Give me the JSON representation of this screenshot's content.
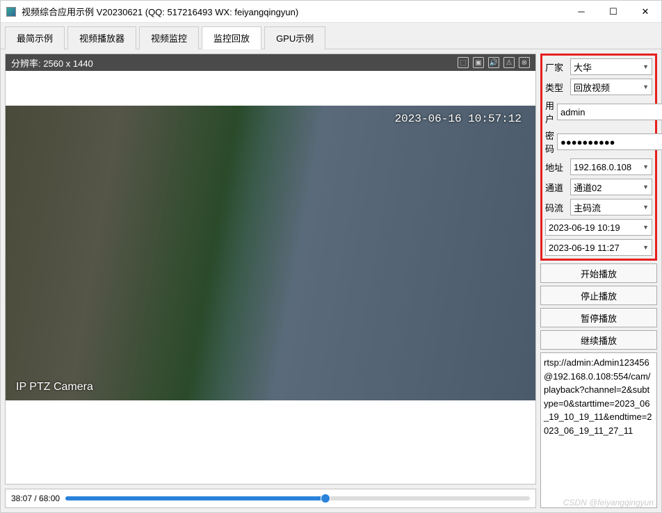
{
  "window": {
    "title": "视频综合应用示例 V20230621 (QQ: 517216493 WX: feiyangqingyun)"
  },
  "tabs": {
    "items": [
      {
        "label": "最简示例"
      },
      {
        "label": "视频播放器"
      },
      {
        "label": "视频监控"
      },
      {
        "label": "监控回放"
      },
      {
        "label": "GPU示例"
      }
    ],
    "active_index": 3
  },
  "video": {
    "resolution_label": "分辨率: 2560 x 1440",
    "osd_timestamp": "2023-06-16 10:57:12",
    "osd_camera": "IP PTZ Camera"
  },
  "progress": {
    "time_label": "38:07 / 68:00",
    "percent": 56
  },
  "form": {
    "vendor": {
      "label": "厂家",
      "value": "大华"
    },
    "type": {
      "label": "类型",
      "value": "回放视频"
    },
    "user": {
      "label": "用户",
      "value": "admin"
    },
    "password": {
      "label": "密码",
      "value": "●●●●●●●●●●"
    },
    "address": {
      "label": "地址",
      "value": "192.168.0.108"
    },
    "channel": {
      "label": "通道",
      "value": "通道02"
    },
    "stream": {
      "label": "码流",
      "value": "主码流"
    },
    "start_time": "2023-06-19 10:19",
    "end_time": "2023-06-19 11:27"
  },
  "buttons": {
    "start": "开始播放",
    "stop": "停止播放",
    "pause": "暂停播放",
    "resume": "继续播放"
  },
  "url_text": "rtsp://admin:Admin123456@192.168.0.108:554/cam/playback?channel=2&subtype=0&starttime=2023_06_19_10_19_11&endtime=2023_06_19_11_27_11",
  "watermark": "CSDN @feiyangqingyun"
}
